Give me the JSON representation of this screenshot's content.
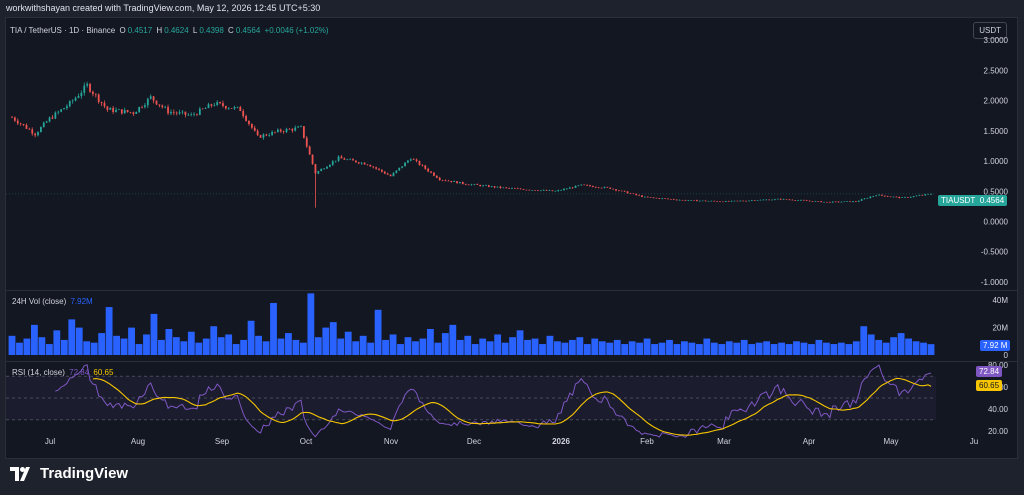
{
  "header": {
    "text": "workwithshayan created with TradingView.com, May 12, 2026 12:45 UTC+5:30"
  },
  "symbol": {
    "title": "TIA / TetherUS · 1D · Binance",
    "o_label": "O",
    "o_value": "0.4517",
    "h_label": "H",
    "h_value": "0.4624",
    "l_label": "L",
    "l_value": "0.4398",
    "c_label": "C",
    "c_value": "0.4564",
    "change": "+0.0046 (+1.02%)"
  },
  "currency_button": "USDT",
  "price_tag": {
    "ticker": "TIAUSDT",
    "value": "0.4564"
  },
  "volume": {
    "label": "24H Vol (close)",
    "value": "7.92M",
    "tag": "7.92 M"
  },
  "rsi": {
    "label": "RSI (14, close)",
    "value": "72.84",
    "ma_value": "60.65",
    "tag_rsi": "72.84",
    "tag_ma": "60.65"
  },
  "footer": {
    "brand": "TradingView"
  },
  "colors": {
    "up": "#26a69a",
    "down": "#ef5350",
    "volume": "#2962ff",
    "rsi": "#7e57c2",
    "rsi_ma": "#f7c600",
    "bg": "#131722"
  },
  "chart_data": [
    {
      "type": "candlestick",
      "title": "TIA / TetherUS · 1D · Binance",
      "y_ticks": [
        "3.0000",
        "2.5000",
        "2.0000",
        "1.5000",
        "1.0000",
        "0.5000",
        "0.0000",
        "-0.5000",
        "-1.0000"
      ],
      "ylim": [
        -1.1,
        3.2
      ],
      "x_ticks": [
        "Jul",
        "Aug",
        "Sep",
        "Oct",
        "Nov",
        "Dec",
        "2026",
        "Feb",
        "Mar",
        "Apr",
        "May",
        "Ju"
      ],
      "close_path_approx": [
        {
          "x": "Jun 27",
          "y": 1.72
        },
        {
          "x": "Jul 5",
          "y": 1.45
        },
        {
          "x": "Jul 10",
          "y": 1.7
        },
        {
          "x": "Jul 17",
          "y": 1.95
        },
        {
          "x": "Jul 23",
          "y": 2.25
        },
        {
          "x": "Jul 30",
          "y": 1.85
        },
        {
          "x": "Aug 8",
          "y": 1.8
        },
        {
          "x": "Aug 14",
          "y": 2.05
        },
        {
          "x": "Aug 20",
          "y": 1.82
        },
        {
          "x": "Aug 28",
          "y": 1.75
        },
        {
          "x": "Sep 5",
          "y": 1.95
        },
        {
          "x": "Sep 14",
          "y": 1.85
        },
        {
          "x": "Sep 20",
          "y": 1.4
        },
        {
          "x": "Sep 28",
          "y": 1.5
        },
        {
          "x": "Oct 5",
          "y": 1.55
        },
        {
          "x": "Oct 10",
          "y": 0.8
        },
        {
          "x": "Oct 18",
          "y": 1.05
        },
        {
          "x": "Oct 28",
          "y": 0.95
        },
        {
          "x": "Nov 5",
          "y": 0.75
        },
        {
          "x": "Nov 12",
          "y": 1.05
        },
        {
          "x": "Nov 22",
          "y": 0.7
        },
        {
          "x": "Dec 1",
          "y": 0.62
        },
        {
          "x": "Dec 15",
          "y": 0.55
        },
        {
          "x": "Jan 1",
          "y": 0.5
        },
        {
          "x": "Jan 10",
          "y": 0.6
        },
        {
          "x": "Jan 20",
          "y": 0.55
        },
        {
          "x": "Feb 1",
          "y": 0.4
        },
        {
          "x": "Feb 15",
          "y": 0.35
        },
        {
          "x": "Mar 1",
          "y": 0.33
        },
        {
          "x": "Mar 20",
          "y": 0.37
        },
        {
          "x": "Apr 5",
          "y": 0.32
        },
        {
          "x": "Apr 15",
          "y": 0.33
        },
        {
          "x": "Apr 22",
          "y": 0.44
        },
        {
          "x": "May 1",
          "y": 0.39
        },
        {
          "x": "May 11",
          "y": 0.4564
        }
      ],
      "last": {
        "open": 0.4517,
        "high": 0.4624,
        "low": 0.4398,
        "close": 0.4564
      }
    },
    {
      "type": "bar",
      "title": "24H Vol (close)",
      "y_ticks": [
        "40M",
        "20M",
        "0"
      ],
      "ylim": [
        0,
        46
      ],
      "last_value_m": 7.92,
      "values_approx_m": [
        14,
        9,
        12,
        22,
        13,
        8,
        18,
        11,
        26,
        20,
        10,
        9,
        16,
        35,
        14,
        12,
        20,
        8,
        15,
        30,
        11,
        19,
        13,
        10,
        17,
        9,
        12,
        21,
        13,
        15,
        8,
        11,
        25,
        14,
        10,
        38,
        12,
        16,
        11,
        9,
        45,
        13,
        20,
        24,
        12,
        17,
        10,
        14,
        9,
        33,
        11,
        15,
        8,
        13,
        10,
        12,
        19,
        9,
        16,
        22,
        11,
        14,
        8,
        12,
        10,
        15,
        9,
        13,
        18,
        11,
        12,
        8,
        14,
        10,
        9,
        11,
        13,
        8,
        12,
        10,
        9,
        11,
        8,
        10,
        9,
        12,
        8,
        9,
        11,
        8,
        10,
        9,
        8,
        12,
        9,
        8,
        10,
        9,
        11,
        8,
        9,
        10,
        8,
        9,
        8,
        10,
        9,
        8,
        11,
        9,
        8,
        9,
        8,
        10,
        21,
        15,
        11,
        9,
        13,
        16,
        12,
        10,
        9,
        8
      ]
    },
    {
      "type": "line",
      "title": "RSI (14, close)",
      "y_ticks": [
        "80.00",
        "60.00",
        "40.00",
        "20.00"
      ],
      "ylim": [
        18,
        82
      ],
      "series": [
        {
          "name": "RSI",
          "last": 72.84
        },
        {
          "name": "MA",
          "last": 60.65
        }
      ]
    }
  ]
}
